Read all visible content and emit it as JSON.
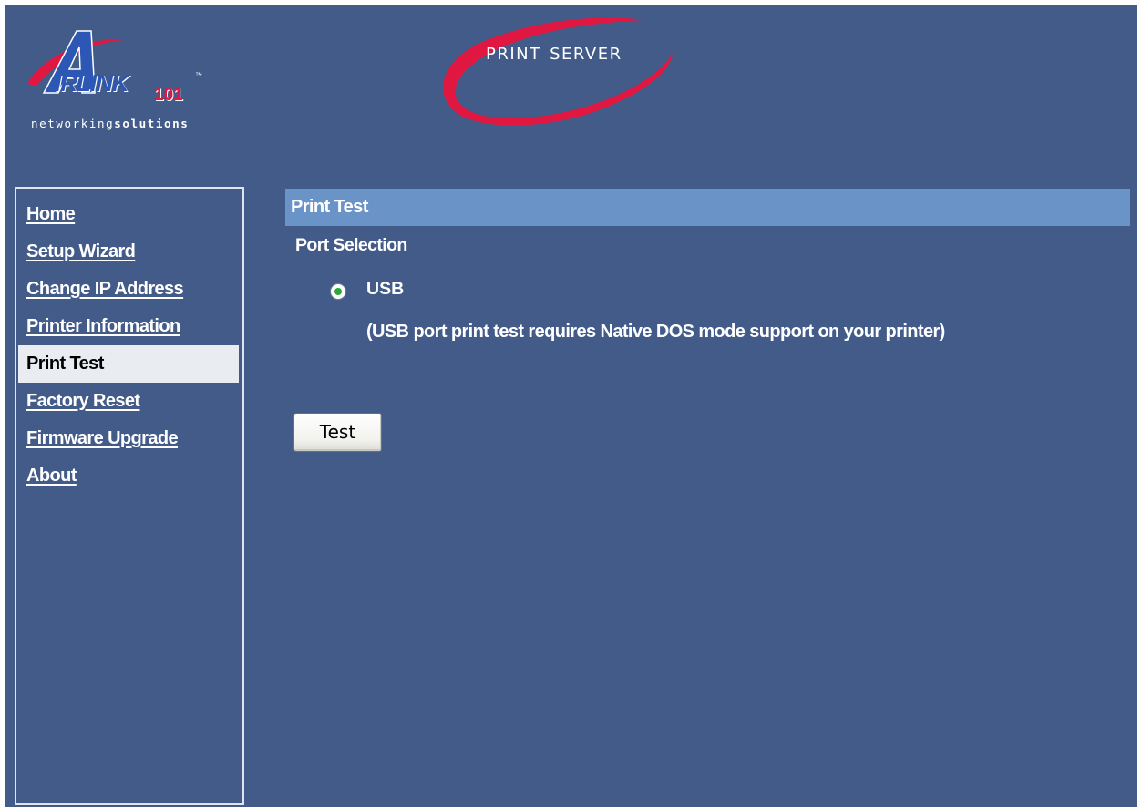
{
  "header": {
    "brand_text": "IRLINK",
    "brand_number": "101",
    "brand_tm": "™",
    "tagline_light": "networking",
    "tagline_bold": "solutions",
    "product_title": "Print Server",
    "swoosh_color": "#e01841"
  },
  "sidebar": {
    "items": [
      {
        "label": "Home",
        "active": false
      },
      {
        "label": "Setup Wizard",
        "active": false
      },
      {
        "label": "Change IP Address",
        "active": false
      },
      {
        "label": "Printer Information",
        "active": false
      },
      {
        "label": "Print Test",
        "active": true
      },
      {
        "label": "Factory Reset",
        "active": false
      },
      {
        "label": "Firmware Upgrade",
        "active": false
      },
      {
        "label": "About",
        "active": false
      }
    ]
  },
  "main": {
    "section_title": "Print Test",
    "port_selection_label": "Port Selection",
    "port_option": {
      "label": "USB",
      "selected": true
    },
    "usb_note": "(USB port print test requires Native DOS mode support on your printer)",
    "test_button_label": "Test"
  },
  "colors": {
    "background": "#425b89",
    "section_bar": "#6a93c8",
    "active_nav": "#e9ecf1",
    "brand_red": "#e01841",
    "brand_blue": "#2d57b5"
  }
}
